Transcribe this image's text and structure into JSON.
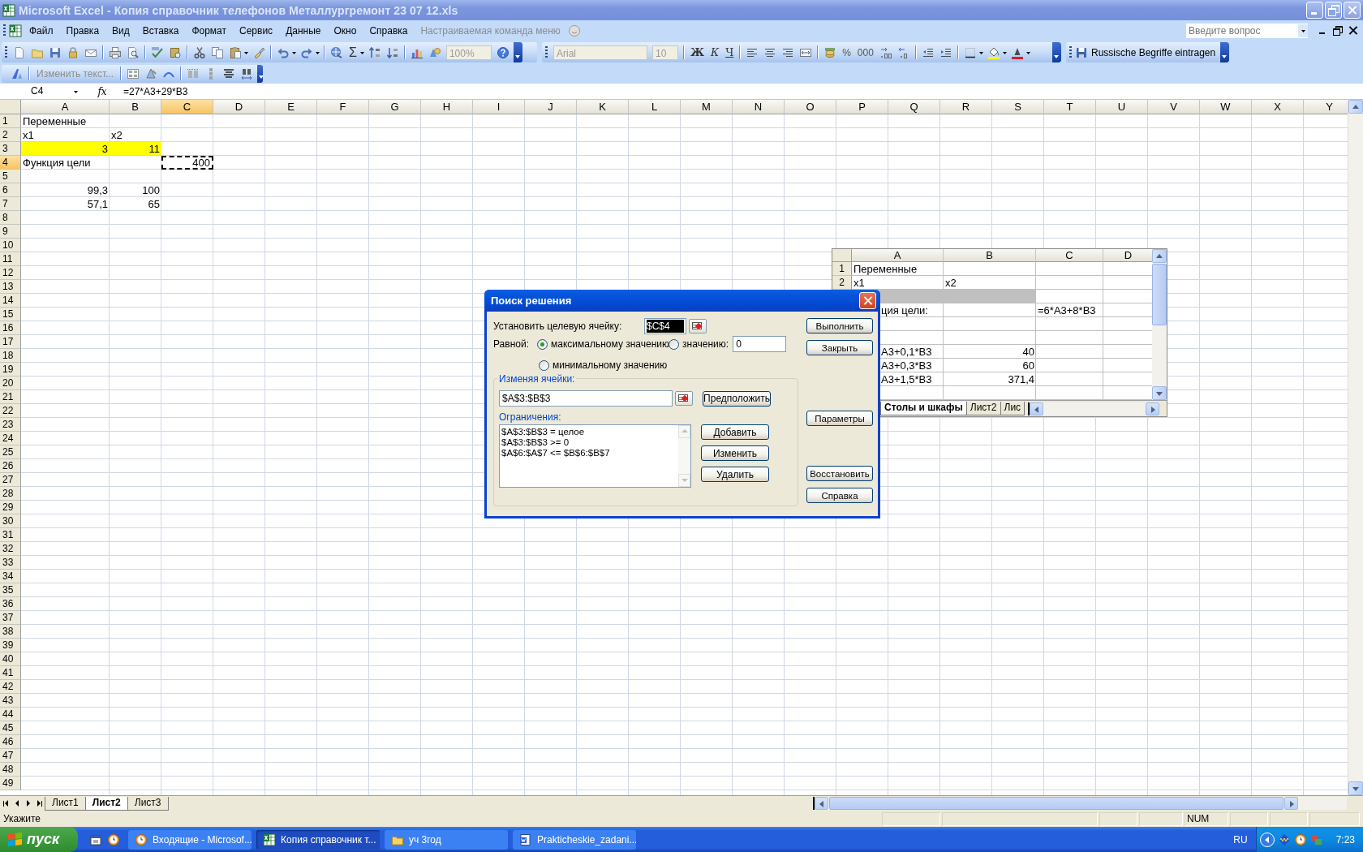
{
  "window": {
    "title": "Microsoft Excel - Копия справочник телефонов Металлургремонт 23 07 12.xls",
    "active": false
  },
  "menu": {
    "items": [
      {
        "label": "Файл",
        "disabled": false
      },
      {
        "label": "Правка",
        "disabled": false
      },
      {
        "label": "Вид",
        "disabled": false
      },
      {
        "label": "Вставка",
        "disabled": false
      },
      {
        "label": "Формат",
        "disabled": false
      },
      {
        "label": "Сервис",
        "disabled": false
      },
      {
        "label": "Данные",
        "disabled": false
      },
      {
        "label": "Окно",
        "disabled": false
      },
      {
        "label": "Справка",
        "disabled": false
      },
      {
        "label": "Настраиваемая команда меню",
        "disabled": true
      }
    ],
    "help_search": {
      "placeholder": "Введите вопрос"
    }
  },
  "standard_toolbar": {
    "autosum": "Σ",
    "zoom": {
      "value": "100%",
      "disabled": true
    }
  },
  "formatting_toolbar": {
    "font": {
      "value": "Arial",
      "disabled": true
    },
    "size": {
      "value": "10",
      "disabled": true
    },
    "style_buttons": [
      "Ж",
      "К",
      "Ч"
    ],
    "number_buttons": [
      "%",
      "000"
    ],
    "macro_button": "Russische Begriffe eintragen"
  },
  "wordart_toolbar": {
    "edit_text": {
      "label": "Изменить текст...",
      "disabled": true
    }
  },
  "formula_bar": {
    "name_box": "C4",
    "fx": "fx",
    "formula": "=27*A3+29*B3"
  },
  "sheet": {
    "columns": [
      "A",
      "B",
      "C",
      "D",
      "E",
      "F",
      "G",
      "H",
      "I",
      "J",
      "K",
      "L",
      "M",
      "N",
      "O",
      "P",
      "Q",
      "R",
      "S",
      "T",
      "U",
      "V",
      "W",
      "X",
      "Y"
    ],
    "rows": [
      {
        "number": "1",
        "cells": [
          {
            "kind": "text",
            "text": "Переменные",
            "selected": false,
            "highlighted": false
          }
        ]
      },
      {
        "number": "2",
        "cells": [
          {
            "kind": "text",
            "text": "x1",
            "selected": false,
            "highlighted": false
          },
          {
            "kind": "text",
            "text": "x2",
            "selected": false,
            "highlighted": false
          }
        ]
      },
      {
        "number": "3",
        "cells": [
          {
            "kind": "number",
            "text": "3",
            "selected": false,
            "highlighted": true
          },
          {
            "kind": "number",
            "text": "11",
            "selected": false,
            "highlighted": true
          }
        ]
      },
      {
        "number": "4",
        "cells": [
          {
            "kind": "text",
            "text": "Функция цели",
            "selected": false,
            "highlighted": false
          },
          {
            "kind": "empty"
          },
          {
            "kind": "number",
            "text": "400",
            "selected": true,
            "highlighted": false
          }
        ]
      },
      {
        "number": "5"
      },
      {
        "number": "6",
        "cells": [
          {
            "kind": "number",
            "text": "99,3",
            "selected": false,
            "highlighted": false
          },
          {
            "kind": "number",
            "text": "100",
            "selected": false,
            "highlighted": false
          }
        ]
      },
      {
        "number": "7",
        "cells": [
          {
            "kind": "number",
            "text": "57,1",
            "selected": false,
            "highlighted": false
          },
          {
            "kind": "number",
            "text": "65",
            "selected": false,
            "highlighted": false
          }
        ]
      },
      {
        "number": "8"
      },
      {
        "number": "9"
      },
      {
        "number": "10"
      },
      {
        "number": "11"
      },
      {
        "number": "12"
      },
      {
        "number": "13"
      },
      {
        "number": "14"
      },
      {
        "number": "15"
      },
      {
        "number": "16"
      },
      {
        "number": "17"
      },
      {
        "number": "18"
      },
      {
        "number": "19"
      },
      {
        "number": "20"
      },
      {
        "number": "21"
      },
      {
        "number": "22"
      },
      {
        "number": "23"
      },
      {
        "number": "24"
      },
      {
        "number": "25"
      },
      {
        "number": "26"
      },
      {
        "number": "27"
      },
      {
        "number": "28"
      },
      {
        "number": "29"
      },
      {
        "number": "30"
      },
      {
        "number": "31"
      },
      {
        "number": "32"
      },
      {
        "number": "33"
      },
      {
        "number": "34"
      },
      {
        "number": "35"
      },
      {
        "number": "36"
      },
      {
        "number": "37"
      },
      {
        "number": "38"
      },
      {
        "number": "39"
      },
      {
        "number": "40"
      },
      {
        "number": "41"
      },
      {
        "number": "42"
      },
      {
        "number": "43"
      },
      {
        "number": "44"
      },
      {
        "number": "45"
      },
      {
        "number": "46"
      },
      {
        "number": "47"
      },
      {
        "number": "48"
      },
      {
        "number": "49"
      }
    ],
    "tabs": [
      {
        "label": "Лист1",
        "selected": false
      },
      {
        "label": "Лист2",
        "selected": true
      },
      {
        "label": "Лист3",
        "selected": false
      }
    ]
  },
  "embedded_sheet": {
    "columns": [
      "A",
      "B",
      "C",
      "D"
    ],
    "rows": [
      {
        "number": "1",
        "cells": [
          {
            "kind": "text",
            "text": "Переменные"
          }
        ]
      },
      {
        "number": "2",
        "cells": [
          {
            "kind": "text",
            "text": "x1"
          },
          {
            "kind": "text",
            "text": "x2"
          }
        ]
      },
      {
        "cells": [
          {
            "kind": "empty",
            "shaded": true
          },
          {
            "kind": "empty",
            "shaded": true
          }
        ]
      },
      {
        "cells": [
          {
            "kind": "covered-text",
            "text": "ция цели:"
          },
          {
            "kind": "empty"
          },
          {
            "kind": "text",
            "text": "=6*A3+8*B3"
          }
        ]
      },
      {},
      {},
      {
        "cells": [
          {
            "kind": "covered-text",
            "text": "A3+0,1*B3"
          },
          {
            "kind": "number",
            "text": "40"
          }
        ]
      },
      {
        "cells": [
          {
            "kind": "covered-text",
            "text": "A3+0,3*B3"
          },
          {
            "kind": "number",
            "text": "60"
          }
        ]
      },
      {
        "cells": [
          {
            "kind": "covered-text",
            "text": "A3+1,5*B3"
          },
          {
            "kind": "number",
            "text": "371,4"
          }
        ]
      },
      {}
    ],
    "tabs": [
      {
        "label": "Столы и шкафы",
        "selected": true
      },
      {
        "label": "Лист2",
        "selected": false
      },
      {
        "label": "Лис",
        "selected": false
      }
    ]
  },
  "solver_dialog": {
    "title": "Поиск решения",
    "target_label": "Установить целевую ячейку:",
    "target_cell": "$C$4",
    "equal_label": "Равной:",
    "options": [
      {
        "label": "максимальному значению",
        "selected": true
      },
      {
        "label": "значению:",
        "selected": false
      },
      {
        "label": "минимальному значению",
        "selected": false
      }
    ],
    "value": "0",
    "changing_label": "Изменяя ячейки:",
    "changing_cells": "$A$3:$B$3",
    "guess_button": "Предположить",
    "constraints_label": "Ограничения:",
    "constraints": [
      "$A$3:$B$3 = целое",
      "$A$3:$B$3 >= 0",
      "$A$6:$A$7 <= $B$6:$B$7"
    ],
    "constraint_buttons": [
      "Добавить",
      "Изменить",
      "Удалить"
    ],
    "side_buttons": [
      [
        "Выполнить",
        "Закрыть"
      ],
      [
        "Параметры"
      ],
      [
        "Восстановить",
        "Справка"
      ]
    ]
  },
  "status_bar": {
    "message": "Укажите",
    "indicator": "NUM"
  },
  "taskbar": {
    "start": "пуск",
    "tasks": [
      {
        "label": "Входящие - Microsof...",
        "selected": false
      },
      {
        "label": "Копия справочник т...",
        "selected": true
      },
      {
        "label": "уч 3год",
        "selected": false
      },
      {
        "label": "Prakticheskie_zadani...",
        "selected": false
      }
    ],
    "language": "RU",
    "clock": "7:23"
  }
}
